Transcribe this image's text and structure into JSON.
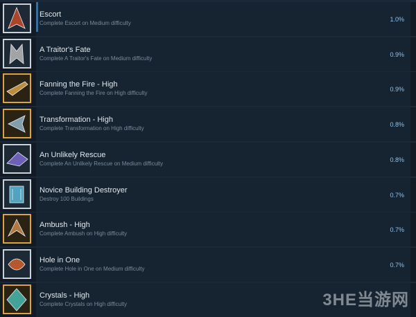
{
  "achievements": [
    {
      "title": "Escort",
      "desc": "Complete Escort on Medium difficulty",
      "pct": "1.0%",
      "frame": "silver",
      "icon": "escort-ship-icon",
      "accent": "#c44a2a"
    },
    {
      "title": "A Traitor's Fate",
      "desc": "Complete A Traitor's Fate on Medium difficulty",
      "pct": "0.9%",
      "frame": "silver",
      "icon": "traitor-ship-icon",
      "accent": "#b8b8b8"
    },
    {
      "title": "Fanning the Fire - High",
      "desc": "Complete Fanning the Fire on High difficulty",
      "pct": "0.9%",
      "frame": "gold",
      "icon": "fire-ship-icon",
      "accent": "#d8a040"
    },
    {
      "title": "Transformation - High",
      "desc": "Complete Transformation on High difficulty",
      "pct": "0.8%",
      "frame": "gold",
      "icon": "transform-ship-icon",
      "accent": "#8fb4c8"
    },
    {
      "title": "An Unlikely Rescue",
      "desc": "Complete An Unlikely Rescue on Medium difficulty",
      "pct": "0.8%",
      "frame": "silver",
      "icon": "rescue-ship-icon",
      "accent": "#7a6ad0"
    },
    {
      "title": "Novice Building Destroyer",
      "desc": "Destroy 100 Buildings",
      "pct": "0.7%",
      "frame": "silver",
      "icon": "building-icon",
      "accent": "#5ab8d8"
    },
    {
      "title": "Ambush - High",
      "desc": "Complete Ambush on High difficulty",
      "pct": "0.7%",
      "frame": "gold",
      "icon": "ambush-ship-icon",
      "accent": "#c8884a"
    },
    {
      "title": "Hole in One",
      "desc": "Complete Hole in One on Medium difficulty",
      "pct": "0.7%",
      "frame": "silver",
      "icon": "hole-in-one-icon",
      "accent": "#d0602a"
    },
    {
      "title": "Crystals - High",
      "desc": "Complete Crystals on High difficulty",
      "pct": "",
      "frame": "gold",
      "icon": "crystals-ship-icon",
      "accent": "#4ab8b0"
    }
  ],
  "watermark": {
    "text": "3HE当游网"
  }
}
